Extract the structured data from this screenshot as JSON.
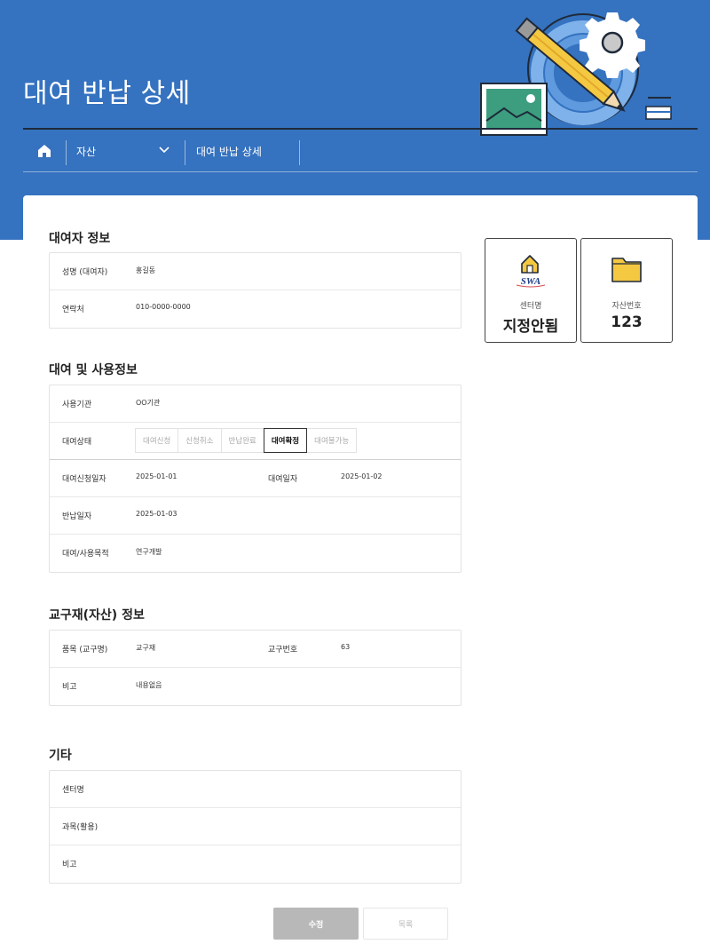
{
  "header": {
    "title": "대여 반납 상세",
    "breadcrumb": {
      "home_icon": "home-icon",
      "level1": "자산",
      "level2": "대여 반납 상세"
    }
  },
  "summary_cards": {
    "center": {
      "icon": "house-logo-icon",
      "logo_text": "SWA",
      "label": "센터명",
      "value": "지정안됨"
    },
    "asset": {
      "icon": "folder-icon",
      "label": "자산번호",
      "value": "123"
    }
  },
  "borrower": {
    "title": "대여자 정보",
    "rows": [
      {
        "label": "성명 (대여자)",
        "value": "홍길동"
      },
      {
        "label": "연락처",
        "value": "010-0000-0000"
      }
    ]
  },
  "rental": {
    "title": "대여 및 사용정보",
    "org": {
      "label": "사용기관",
      "value": "OO기관"
    },
    "status": {
      "label": "대여상태",
      "options": [
        "대여신청",
        "신청취소",
        "반납완료",
        "대여확정",
        "대여불가능"
      ],
      "selected": "대여확정"
    },
    "request_date": {
      "label": "대여신청일자",
      "value": "2025-01-01"
    },
    "rent_date": {
      "label": "대여일자",
      "value": "2025-01-02"
    },
    "return_date": {
      "label": "반납일자",
      "value": "2025-01-03"
    },
    "purpose": {
      "label": "대여/사용목적",
      "value": "연구개발"
    }
  },
  "asset_info": {
    "title": "교구재(자산) 정보",
    "item": {
      "label": "품목 (교구명)",
      "value": "교구재"
    },
    "number": {
      "label": "교구번호",
      "value": "63"
    },
    "note": {
      "label": "비고",
      "value": "내용없음"
    }
  },
  "etc": {
    "title": "기타",
    "rows": [
      {
        "label": "센터명",
        "value": ""
      },
      {
        "label": "과목(활용)",
        "value": ""
      },
      {
        "label": "비고",
        "value": ""
      }
    ]
  },
  "actions": {
    "edit": "수정",
    "list": "목록"
  },
  "colors": {
    "banner": "#3572bf",
    "accent_yellow": "#f5c842",
    "disabled_button": "#b8b8b8"
  }
}
